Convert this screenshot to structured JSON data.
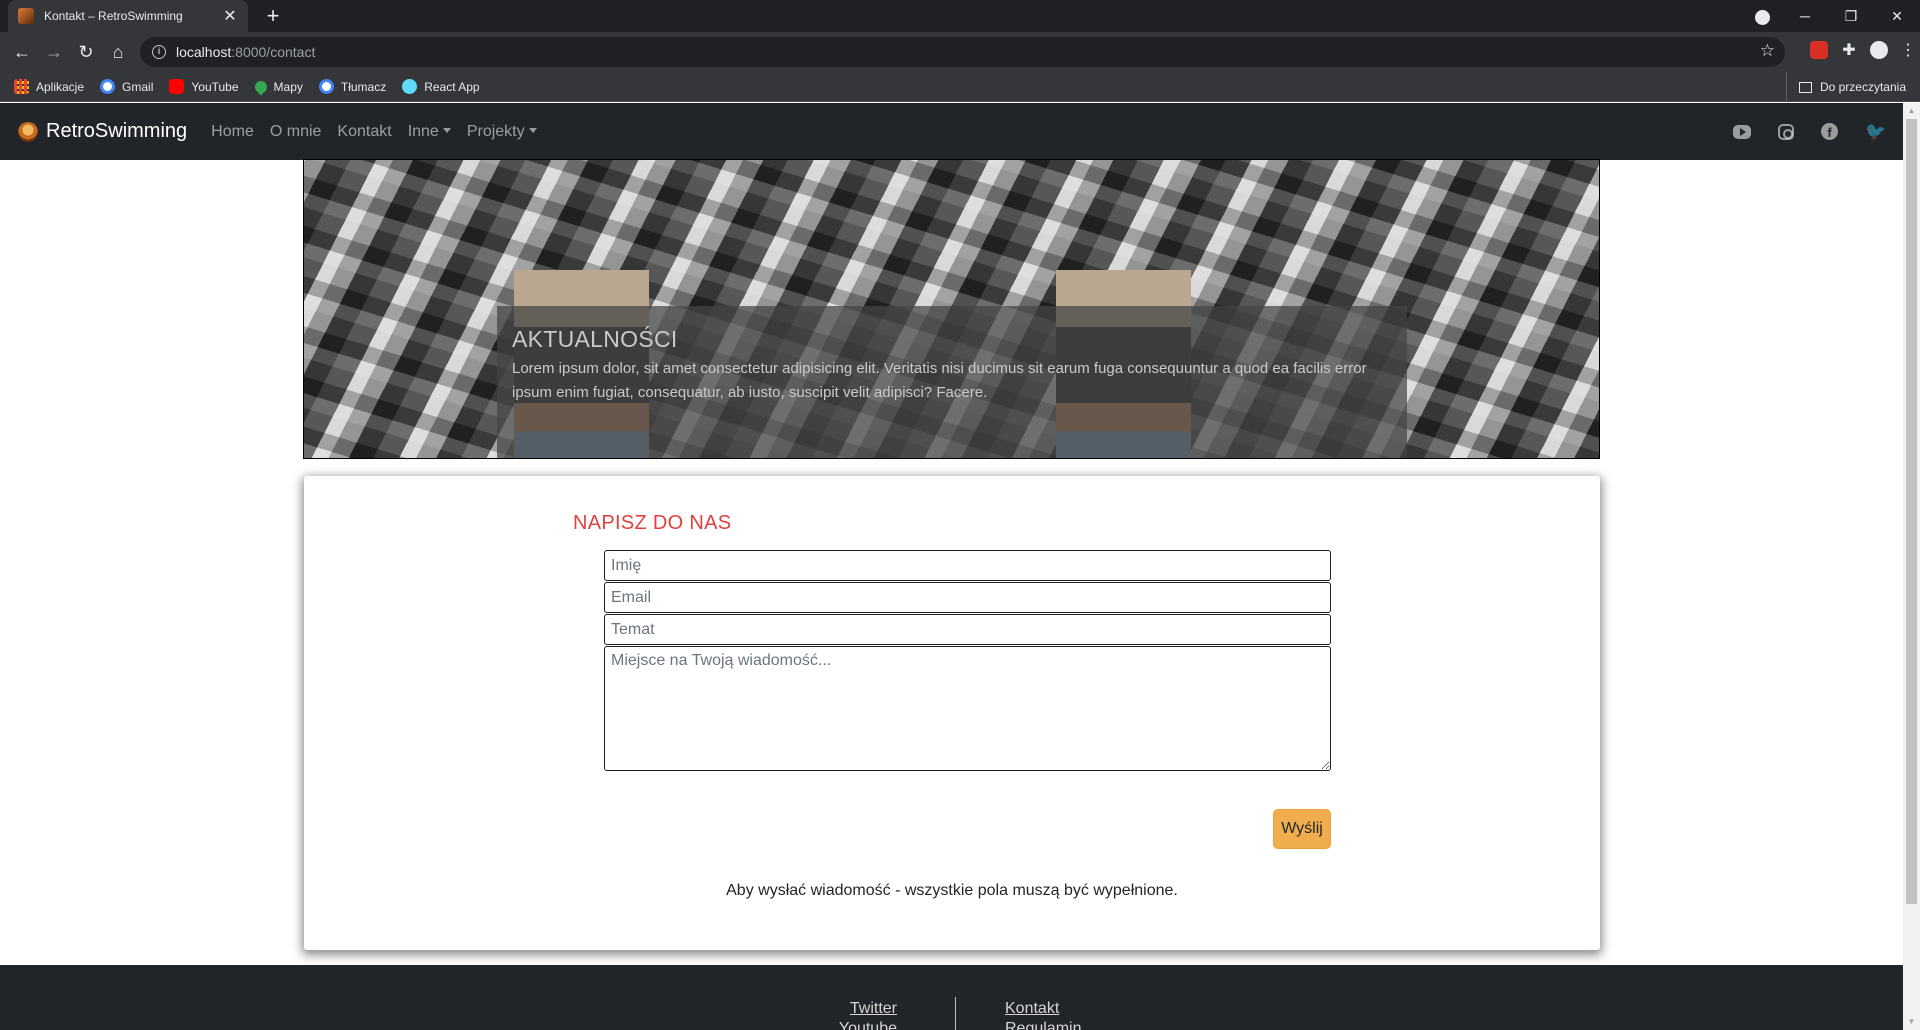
{
  "browser": {
    "tab_title": "Kontakt – RetroSwimming",
    "new_tab": "+",
    "close_tab": "✕",
    "url_host": "localhost",
    "url_path": ":8000/contact",
    "bookmarks": [
      {
        "label": "Aplikacje",
        "icon": "apps-grid-icon"
      },
      {
        "label": "Gmail",
        "icon": "google-icon"
      },
      {
        "label": "YouTube",
        "icon": "youtube-icon"
      },
      {
        "label": "Mapy",
        "icon": "maps-icon"
      },
      {
        "label": "Tłumacz",
        "icon": "google-icon"
      },
      {
        "label": "React App",
        "icon": "react-icon"
      }
    ],
    "reading_list": "Do przeczytania"
  },
  "navbar": {
    "brand": "RetroSwimming",
    "links": [
      "Home",
      "O mnie",
      "Kontakt",
      "Inne",
      "Projekty"
    ],
    "social_icons": [
      "youtube-icon",
      "instagram-icon",
      "facebook-icon",
      "twitter-icon"
    ]
  },
  "hero": {
    "title": "AKTUALNOŚCI",
    "text": "Lorem ipsum dolor, sit amet consectetur adipisicing elit. Veritatis nisi ducimus sit earum fuga consequuntur a quod ea facilis error ipsum enim fugiat, consequatur, ab iusto, suscipit velit adipisci? Facere."
  },
  "contact": {
    "title": "NAPISZ DO NAS",
    "name_placeholder": "Imię",
    "email_placeholder": "Email",
    "subject_placeholder": "Temat",
    "message_placeholder": "Miejsce na Twoją wiadomość...",
    "send_label": "Wyślij",
    "note": "Aby wysłać wiadomość - wszystkie pola muszą być wypełnione."
  },
  "footer": {
    "left_links": [
      "Twitter",
      "Youtube"
    ],
    "right_links": [
      "Kontakt",
      "Regulamin"
    ]
  },
  "colors": {
    "navbar_bg": "#212529",
    "accent_red": "#e0413c",
    "button_orange": "#f0ad4e"
  }
}
